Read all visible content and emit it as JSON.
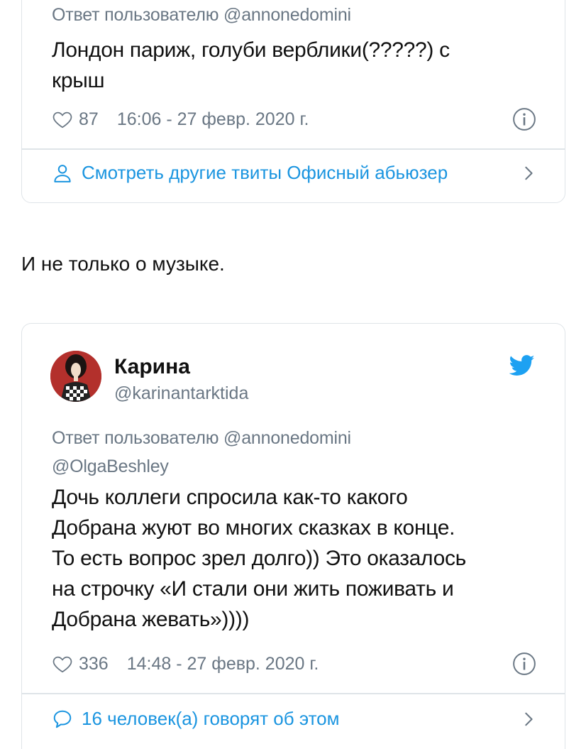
{
  "tweet1": {
    "reply_line": "Ответ пользователю @annonedomini",
    "text_line1": "Лондон париж, голуби верблики(?????) с",
    "text_line2": "крыш",
    "likes": "87",
    "timestamp": "16:06 - 27 февр. 2020 г.",
    "footer_label": "Смотреть другие твиты Офисный абьюзер",
    "footer_icon": "person-icon"
  },
  "between_text": "И не только о музыке.",
  "tweet2": {
    "display_name": "Карина",
    "handle": "@karinantarktida",
    "reply_line1": "Ответ пользователю @annonedomini",
    "reply_line2": "@OlgaBeshley",
    "text_lines": [
      "Дочь коллеги спросила как-то какого",
      "Добрана жуют во многих сказках в конце.",
      "То есть вопрос зрел долго)) Это оказалось",
      "на строчку «И стали они жить поживать и",
      "Добрана жевать»))))"
    ],
    "likes": "336",
    "timestamp": "14:48 - 27 февр. 2020 г.",
    "footer_label": "16 человек(а) говорят об этом",
    "footer_icon": "speech-bubble-icon"
  },
  "colors": {
    "link_blue": "#1b95e0",
    "meta_gray": "#6a7784",
    "border": "#dfe4e8",
    "twitter_blue": "#1da1f2"
  }
}
